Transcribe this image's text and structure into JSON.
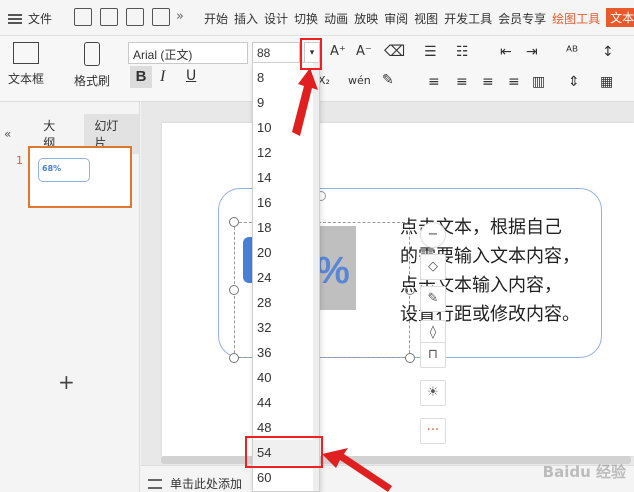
{
  "menubar": {
    "file_label": "文件",
    "more_label": "»",
    "tabs": [
      "开始",
      "插入",
      "设计",
      "切换",
      "动画",
      "放映",
      "审阅",
      "视图",
      "开发工具",
      "会员专享",
      "绘图工具",
      "文本工具"
    ]
  },
  "ribbon": {
    "textbox_label": "文本框",
    "format_painter_label": "格式刷",
    "font_name": "Arial (正文)",
    "font_size": "88",
    "bold_label": "B",
    "italic_label": "I",
    "underline_label": "U",
    "increase_font": "A⁺",
    "decrease_font": "A⁻",
    "subscript_label": "X₂",
    "phonetic_label": "wén",
    "dropdown_arrow": "▾"
  },
  "left_panel": {
    "collapse_label": "«",
    "tab_outline": "大纲",
    "tab_slides": "幻灯片",
    "slide_number": "1",
    "thumb_percent": "68%",
    "add_label": "+"
  },
  "slide": {
    "percent": "%",
    "body_lines": [
      "点击文本，根据自己",
      "的需要输入文本内容，",
      "点击文本输入内容，",
      "设置行距或修改内容。"
    ]
  },
  "notes_placeholder": "单击此处添加",
  "font_size_options": [
    "8",
    "9",
    "10",
    "12",
    "14",
    "16",
    "18",
    "20",
    "24",
    "28",
    "32",
    "36",
    "40",
    "44",
    "48",
    "54",
    "60"
  ],
  "highlighted_option": "54",
  "watermark": "Baidu 经验",
  "colors": {
    "accent": "#e85a2c",
    "highlight": "#e22222",
    "slide_blue": "#4a7fd8"
  }
}
